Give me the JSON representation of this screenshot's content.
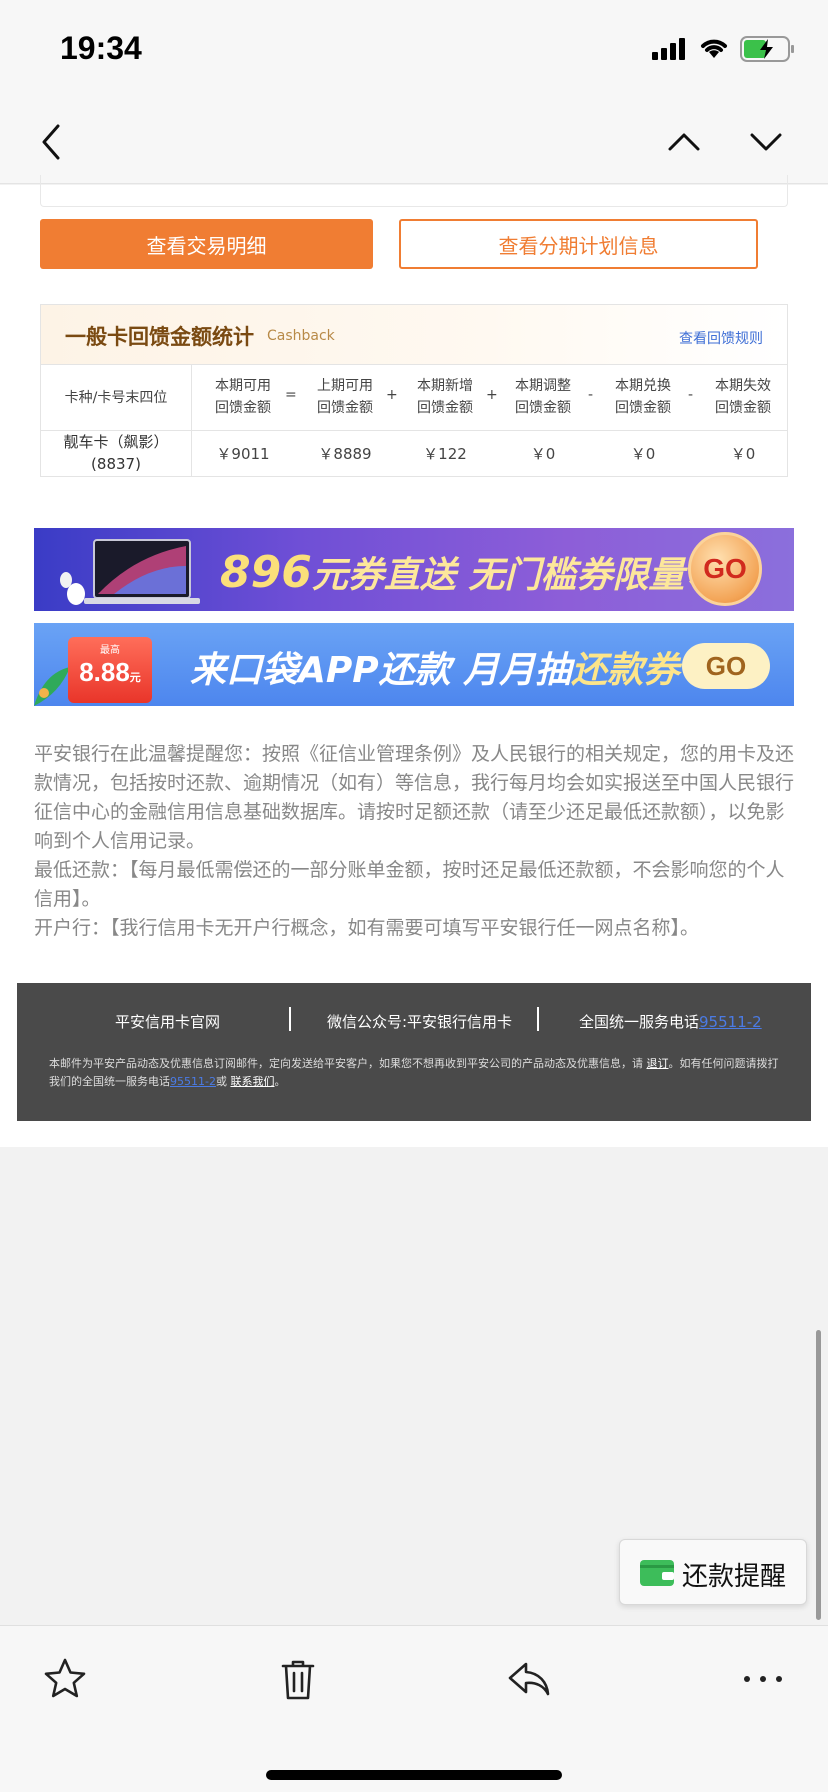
{
  "status_bar": {
    "time": "19:34"
  },
  "email": {
    "buttons": {
      "transactions": "查看交易明细",
      "installments": "查看分期计划信息"
    },
    "cashback": {
      "title": "一般卡回馈金额统计",
      "subtitle": "Cashback",
      "rules_link": "查看回馈规则",
      "headers": {
        "card": "卡种/卡号末四位",
        "cols": [
          [
            "本期可用",
            "回馈金额"
          ],
          [
            "上期可用",
            "回馈金额"
          ],
          [
            "本期新增",
            "回馈金额"
          ],
          [
            "本期调整",
            "回馈金额"
          ],
          [
            "本期兑换",
            "回馈金额"
          ],
          [
            "本期失效",
            "回馈金额"
          ]
        ],
        "operators": [
          "=",
          "+",
          "+",
          "-",
          "-"
        ]
      },
      "row": {
        "card_line1": "靓车卡（飙影）",
        "card_line2": "(8837)",
        "values": [
          "￥9011",
          "￥8889",
          "￥122",
          "￥0",
          "￥0",
          "￥0"
        ]
      }
    },
    "banners": {
      "banner1": {
        "amount": "896",
        "text": "元券直送 无门槛券限量领",
        "go": "GO"
      },
      "banner2": {
        "badge": "8.88",
        "badge_top": "最高",
        "badge_unit": "元",
        "text_a": "来口袋APP还款  月月抽",
        "text_b": "还款券",
        "go": "GO"
      }
    },
    "notice": {
      "p1": "平安银行在此温馨提醒您：按照《征信业管理条例》及人民银行的相关规定，您的用卡及还款情况，包括按时还款、逾期情况（如有）等信息，我行每月均会如实报送至中国人民银行征信中心的金融信用信息基础数据库。请按时足额还款（请至少还足最低还款额），以免影响到个人信用记录。",
      "p2": "最低还款：【每月最低需偿还的一部分账单金额，按时还足最低还款额，不会影响您的个人信用】。",
      "p3": "开户行：【我行信用卡无开户行概念，如有需要可填写平安银行任一网点名称】。"
    },
    "footer": {
      "link1": "平安信用卡官网",
      "link2": "微信公众号:平安银行信用卡",
      "link3_prefix": "全国统一服务电话",
      "phone": "95511-2",
      "small_a": "本邮件为平安产品动态及优惠信息订阅邮件，定向发送给平安客户，如果您不想再收到平安公司的产品动态及优惠信息，请",
      "unsubscribe": "退订",
      "small_b": "。如有任何问题请拨打我们的全国统一服务电话",
      "small_c": "或",
      "contact": "联系我们",
      "small_d": "。"
    }
  },
  "reminder": {
    "label": "还款提醒"
  },
  "colors": {
    "accent": "#f07d33",
    "link": "#3f6fd6",
    "footer_bg": "#4a4a4a"
  }
}
